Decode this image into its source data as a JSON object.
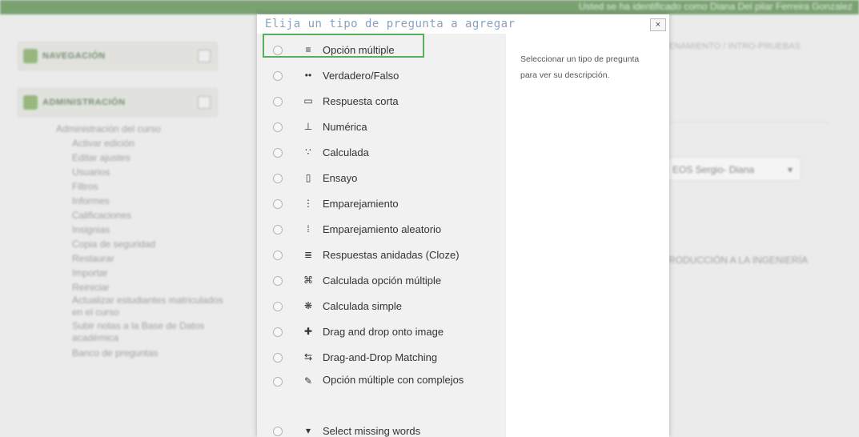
{
  "background": {
    "user_text": "Usted se ha identificado como Diana Del pilar Ferreira Gonzalez",
    "nav_block": "NAVEGACIÓN",
    "admin_block": "ADMINISTRACIÓN",
    "admin_items": [
      "Administración del curso",
      "Activar edición",
      "Editar ajustes",
      "Usuarios",
      "Filtros",
      "Informes",
      "Calificaciones",
      "Insignias",
      "Copia de seguridad",
      "Restaurar",
      "Importar",
      "Reiniciar",
      "Actualizar estudiantes matriculados en el curso",
      "Subir notas a la Base de Datos académica",
      "Banco de preguntas"
    ],
    "breadcrumb": "ENAMIENTO / INTRO-PRUEBAS",
    "select_value": "EOS Sergio- Diana",
    "intro_text": "RODUCCIÓN A LA INGENIERÍA"
  },
  "dialog": {
    "title": "Elija un tipo de pregunta a agregar",
    "close": "×",
    "description": "Seleccionar un tipo de pregunta para ver su descripción.",
    "options": [
      {
        "label": "Opción múltiple",
        "icon": "≡"
      },
      {
        "label": "Verdadero/Falso",
        "icon": "••"
      },
      {
        "label": "Respuesta corta",
        "icon": "▭"
      },
      {
        "label": "Numérica",
        "icon": "⊥"
      },
      {
        "label": "Calculada",
        "icon": "∵"
      },
      {
        "label": "Ensayo",
        "icon": "▯"
      },
      {
        "label": "Emparejamiento",
        "icon": "⋮"
      },
      {
        "label": "Emparejamiento aleatorio",
        "icon": "⁞"
      },
      {
        "label": "Respuestas anidadas (Cloze)",
        "icon": "≣"
      },
      {
        "label": "Calculada opción múltiple",
        "icon": "⌘"
      },
      {
        "label": "Calculada simple",
        "icon": "❋"
      },
      {
        "label": "Drag and drop onto image",
        "icon": "✚"
      },
      {
        "label": "Drag-and-Drop Matching",
        "icon": "⇆"
      },
      {
        "label": "Opción múltiple con complejos",
        "icon": "✎"
      },
      {
        "label": "Select missing words",
        "icon": "▾"
      }
    ]
  }
}
